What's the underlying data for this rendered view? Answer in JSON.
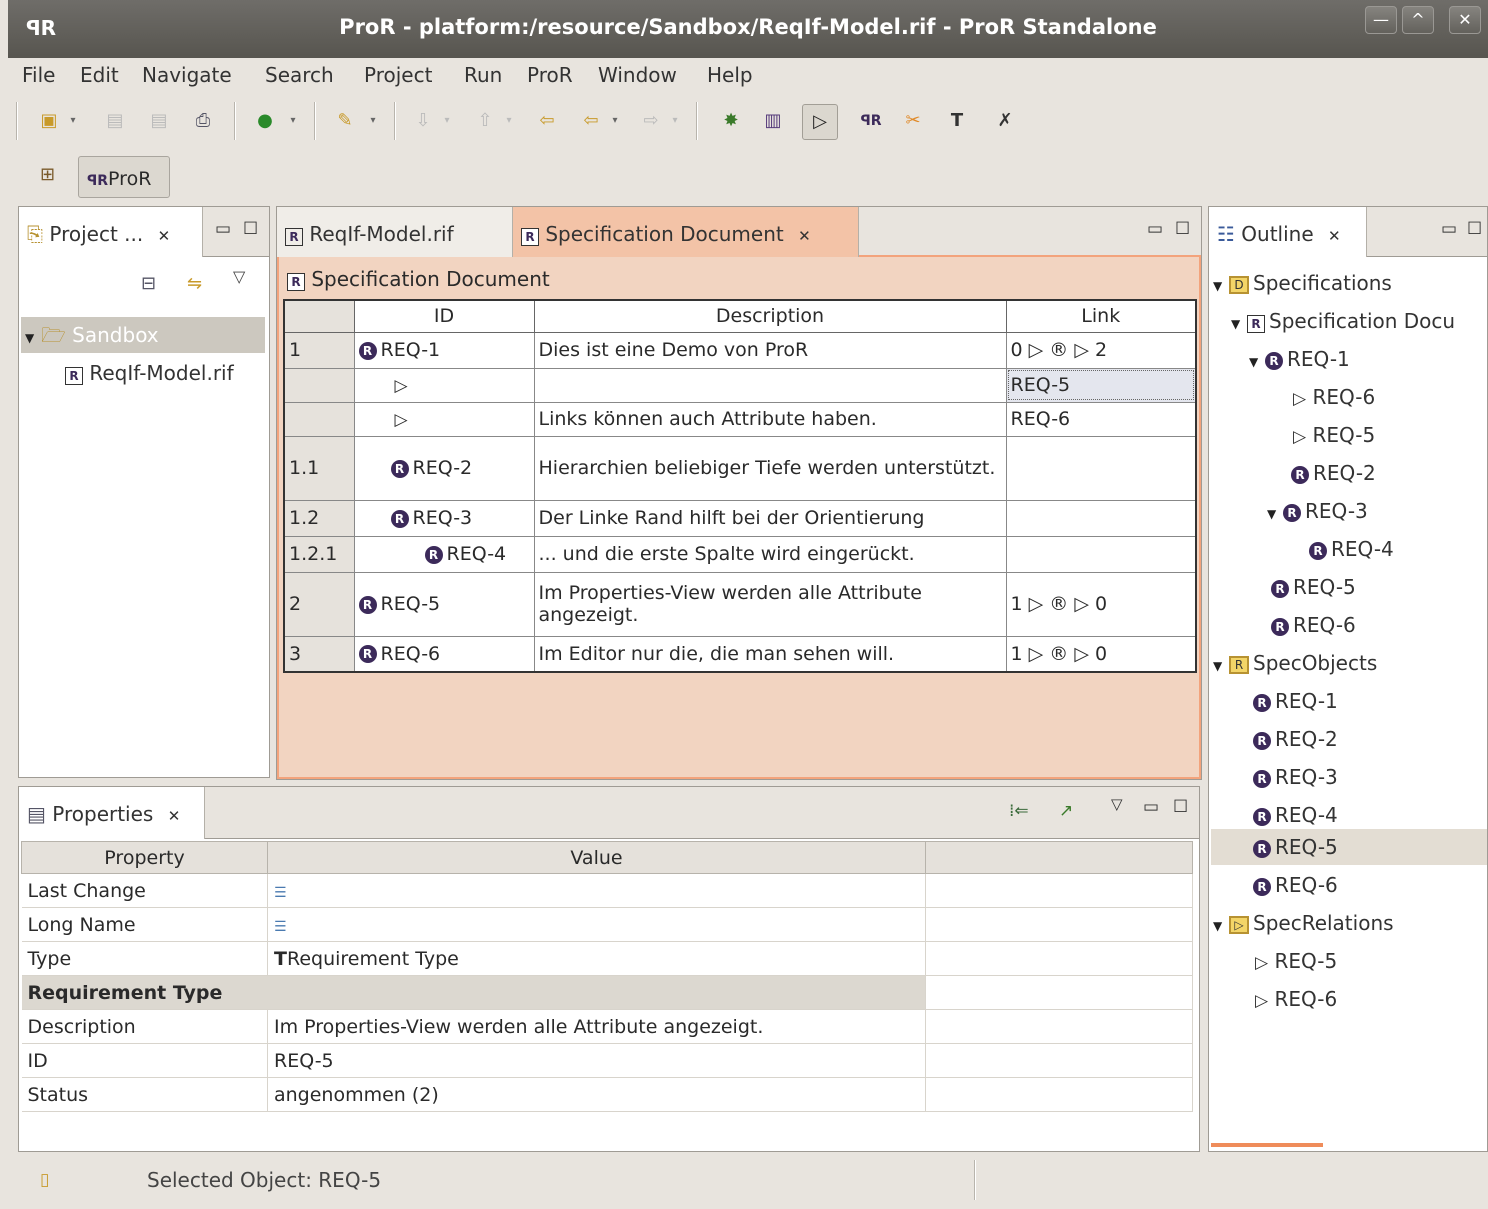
{
  "window": {
    "app_icon": "ProR logo",
    "title": "ProR - platform:/resource/Sandbox/ReqIf-Model.rif - ProR Standalone",
    "controls": [
      "minimize",
      "maximize",
      "close"
    ]
  },
  "menu": [
    "File",
    "Edit",
    "Navigate",
    "Search",
    "Project",
    "Run",
    "ProR",
    "Window",
    "Help"
  ],
  "perspective": {
    "label": "ProR"
  },
  "project_view": {
    "tab_label": "Project ...",
    "tree": [
      {
        "label": "Sandbox",
        "expanded": true
      },
      {
        "label": "ReqIf-Model.rif"
      }
    ]
  },
  "editor": {
    "tabs": [
      {
        "label": "ReqIf-Model.rif",
        "active": false
      },
      {
        "label": "Specification Document",
        "active": true
      }
    ],
    "header": "Specification Document",
    "columns": [
      "ID",
      "Description",
      "Link"
    ],
    "rows": [
      {
        "num": "1",
        "id": "REQ-1",
        "desc": "Dies ist eine Demo von ProR",
        "link": "0 ▷ ® ▷ 2"
      },
      {
        "num": "",
        "id": "",
        "desc": "",
        "link": "REQ-5"
      },
      {
        "num": "",
        "id": "",
        "desc": "Links können auch Attribute haben.",
        "link": "REQ-6"
      },
      {
        "num": "1.1",
        "id": "REQ-2",
        "desc": "Hierarchien beliebiger Tiefe werden unterstützt.",
        "link": ""
      },
      {
        "num": "1.2",
        "id": "REQ-3",
        "desc": "Der Linke Rand hilft bei der Orientierung",
        "link": ""
      },
      {
        "num": "1.2.1",
        "id": "REQ-4",
        "desc": "... und die erste Spalte wird eingerückt.",
        "link": ""
      },
      {
        "num": "2",
        "id": "REQ-5",
        "desc": "Im Properties-View werden alle Attribute angezeigt.",
        "link": "1 ▷ ® ▷ 0"
      },
      {
        "num": "3",
        "id": "REQ-6",
        "desc": "Im Editor nur die, die man sehen will.",
        "link": "1 ▷ ® ▷ 0"
      }
    ]
  },
  "outline": {
    "tab_label": "Outline",
    "tree": [
      {
        "label": "Specifications"
      },
      {
        "label": "Specification Docu"
      },
      {
        "label": "REQ-1"
      },
      {
        "label": "REQ-6"
      },
      {
        "label": "REQ-5"
      },
      {
        "label": "REQ-2"
      },
      {
        "label": "REQ-3"
      },
      {
        "label": "REQ-4"
      },
      {
        "label": "REQ-5"
      },
      {
        "label": "REQ-6"
      },
      {
        "label": "SpecObjects"
      },
      {
        "label": "REQ-1"
      },
      {
        "label": "REQ-2"
      },
      {
        "label": "REQ-3"
      },
      {
        "label": "REQ-4"
      },
      {
        "label": "REQ-5"
      },
      {
        "label": "REQ-6"
      },
      {
        "label": "SpecRelations"
      },
      {
        "label": "REQ-5"
      },
      {
        "label": "REQ-6"
      }
    ]
  },
  "properties": {
    "tab_label": "Properties",
    "columns": [
      "Property",
      "Value"
    ],
    "rows": [
      {
        "property": "Last Change",
        "value": ""
      },
      {
        "property": "Long Name",
        "value": ""
      },
      {
        "property": "Type",
        "value": "Requirement Type"
      },
      {
        "property": "Requirement Type",
        "value": ""
      },
      {
        "property": "Description",
        "value": "Im Properties-View werden alle Attribute angezeigt."
      },
      {
        "property": "ID",
        "value": "REQ-5"
      },
      {
        "property": "Status",
        "value": "angenommen (2)"
      }
    ]
  },
  "status": {
    "text": "Selected Object: REQ-5"
  }
}
